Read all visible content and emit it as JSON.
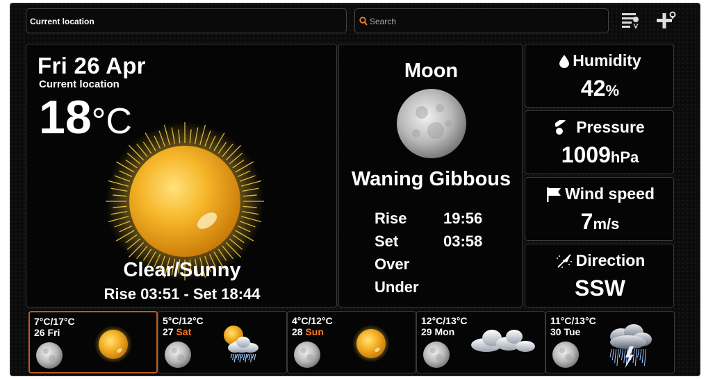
{
  "header": {
    "location_label": "Current location",
    "search_placeholder": "Search"
  },
  "current": {
    "date": "Fri 26 Apr",
    "location": "Current location",
    "temp": "18",
    "unit": "°C",
    "condition": "Clear/Sunny",
    "sun_times": "Rise 03:51 - Set 18:44"
  },
  "moon": {
    "title": "Moon",
    "phase": "Waning Gibbous",
    "rows": [
      {
        "label": "Rise",
        "value": "19:56"
      },
      {
        "label": "Set",
        "value": "03:58"
      },
      {
        "label": "Over",
        "value": ""
      },
      {
        "label": "Under",
        "value": ""
      }
    ]
  },
  "stats": {
    "humidity": {
      "label": "Humidity",
      "value": "42",
      "unit": "%"
    },
    "pressure": {
      "label": "Pressure",
      "value": "1009",
      "unit": "hPa"
    },
    "wind": {
      "label": "Wind speed",
      "value": "7",
      "unit": "m/s"
    },
    "direction": {
      "label": "Direction",
      "value": "SSW"
    }
  },
  "forecast": [
    {
      "range": "7°C/17°C",
      "date": "26",
      "day": "Fri",
      "weekend": false,
      "icon": "sun-icon"
    },
    {
      "range": "5°C/12°C",
      "date": "27",
      "day": "Sat",
      "weekend": true,
      "icon": "sun-cloud-rain-icon"
    },
    {
      "range": "4°C/12°C",
      "date": "28",
      "day": "Sun",
      "weekend": true,
      "icon": "sun-icon"
    },
    {
      "range": "12°C/13°C",
      "date": "29",
      "day": "Mon",
      "weekend": false,
      "icon": "cloud-icon"
    },
    {
      "range": "11°C/13°C",
      "date": "30",
      "day": "Tue",
      "weekend": false,
      "icon": "thunderstorm-icon"
    }
  ],
  "colors": {
    "accent": "#ff7a1a",
    "selected_border": "#c35a1a",
    "panel_border": "#3a3a3a"
  }
}
